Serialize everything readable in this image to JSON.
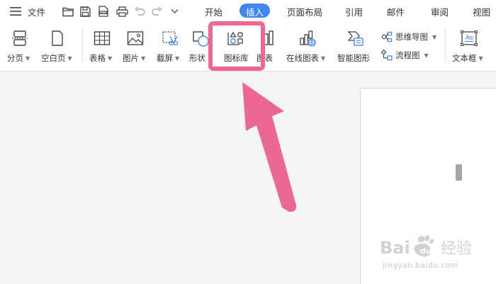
{
  "menubar": {
    "file_label": "文件",
    "tabs": [
      {
        "label": "开始",
        "active": false
      },
      {
        "label": "插入",
        "active": true
      },
      {
        "label": "页面布局",
        "active": false
      },
      {
        "label": "引用",
        "active": false
      },
      {
        "label": "邮件",
        "active": false
      },
      {
        "label": "审阅",
        "active": false
      },
      {
        "label": "视图",
        "active": false
      }
    ],
    "accent_color": "#3f86f0"
  },
  "ribbon": {
    "page_break_label": "分页",
    "blank_page_label": "空白页",
    "table_label": "表格",
    "picture_label": "图片",
    "screenshot_label": "截屏",
    "shapes_label": "形状",
    "icon_library_label": "图标库",
    "chart_label": "图表",
    "online_chart_label": "在线图表",
    "smart_graphic_label": "智能图形",
    "mind_map_label": "思维导图",
    "flowchart_label": "流程图",
    "textbox_label": "文本框"
  },
  "annotation": {
    "highlight_color": "#ec6894"
  },
  "watermark": {
    "text": "Bai du 经验",
    "url": "jingyan.baidu.com"
  }
}
